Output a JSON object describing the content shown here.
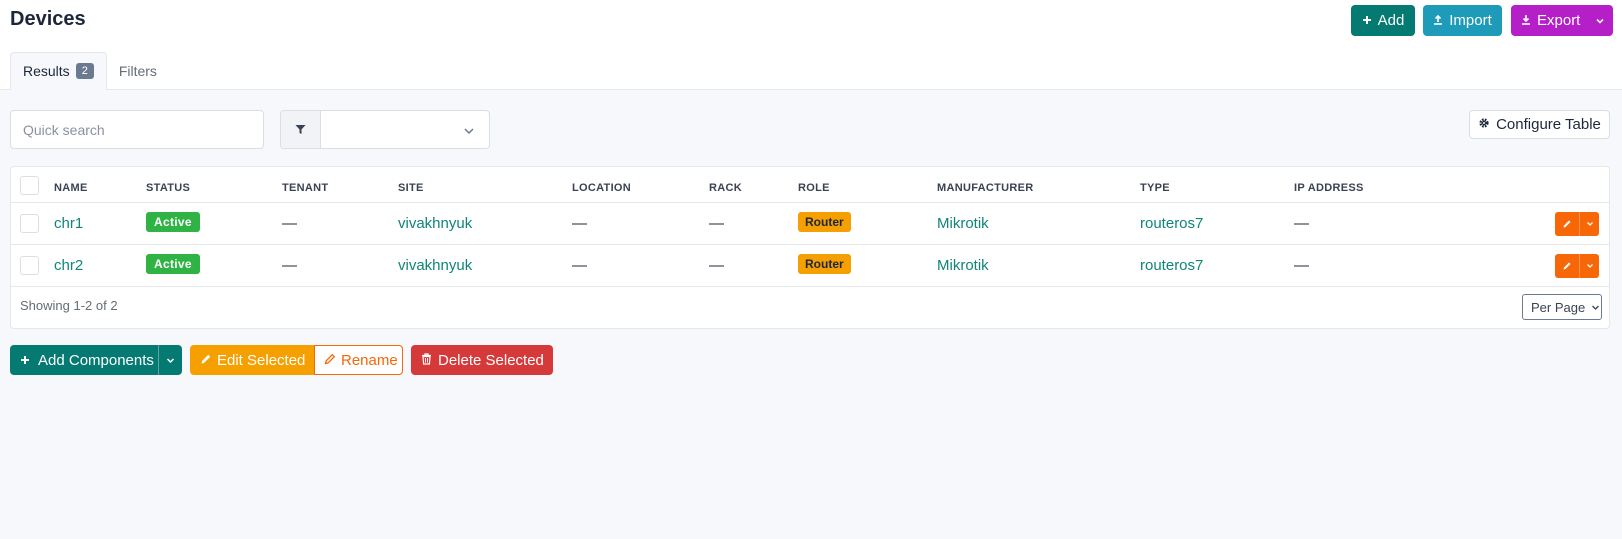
{
  "header": {
    "title": "Devices",
    "add_label": "Add",
    "import_label": "Import",
    "export_label": "Export"
  },
  "tabs": [
    {
      "label": "Results",
      "count": "2",
      "active": true
    },
    {
      "label": "Filters",
      "active": false
    }
  ],
  "search": {
    "placeholder": "Quick search",
    "value": ""
  },
  "filter": {
    "selected": ""
  },
  "configure_table_label": "Configure Table",
  "table": {
    "columns": [
      "NAME",
      "STATUS",
      "TENANT",
      "SITE",
      "LOCATION",
      "RACK",
      "ROLE",
      "MANUFACTURER",
      "TYPE",
      "IP ADDRESS"
    ],
    "rows": [
      {
        "name": "chr1",
        "status": "Active",
        "tenant": "—",
        "site": "vivakhnyuk",
        "location": "—",
        "rack": "—",
        "role": "Router",
        "manufacturer": "Mikrotik",
        "type": "routeros7",
        "ip_address": "—"
      },
      {
        "name": "chr2",
        "status": "Active",
        "tenant": "—",
        "site": "vivakhnyuk",
        "location": "—",
        "rack": "—",
        "role": "Router",
        "manufacturer": "Mikrotik",
        "type": "routeros7",
        "ip_address": "—"
      }
    ],
    "footer_text": "Showing 1-2 of 2",
    "per_page_label": "Per Page"
  },
  "bulk_actions": {
    "add_components_label": "Add Components",
    "edit_selected_label": "Edit Selected",
    "rename_label": "Rename",
    "delete_selected_label": "Delete Selected"
  },
  "colors": {
    "primary": "#047a72",
    "info": "#1d9bb8",
    "purple": "#b51fc7",
    "success": "#2fb344",
    "warning": "#f59f00",
    "orange": "#f76707",
    "danger": "#d63939",
    "link": "#0f8577"
  }
}
